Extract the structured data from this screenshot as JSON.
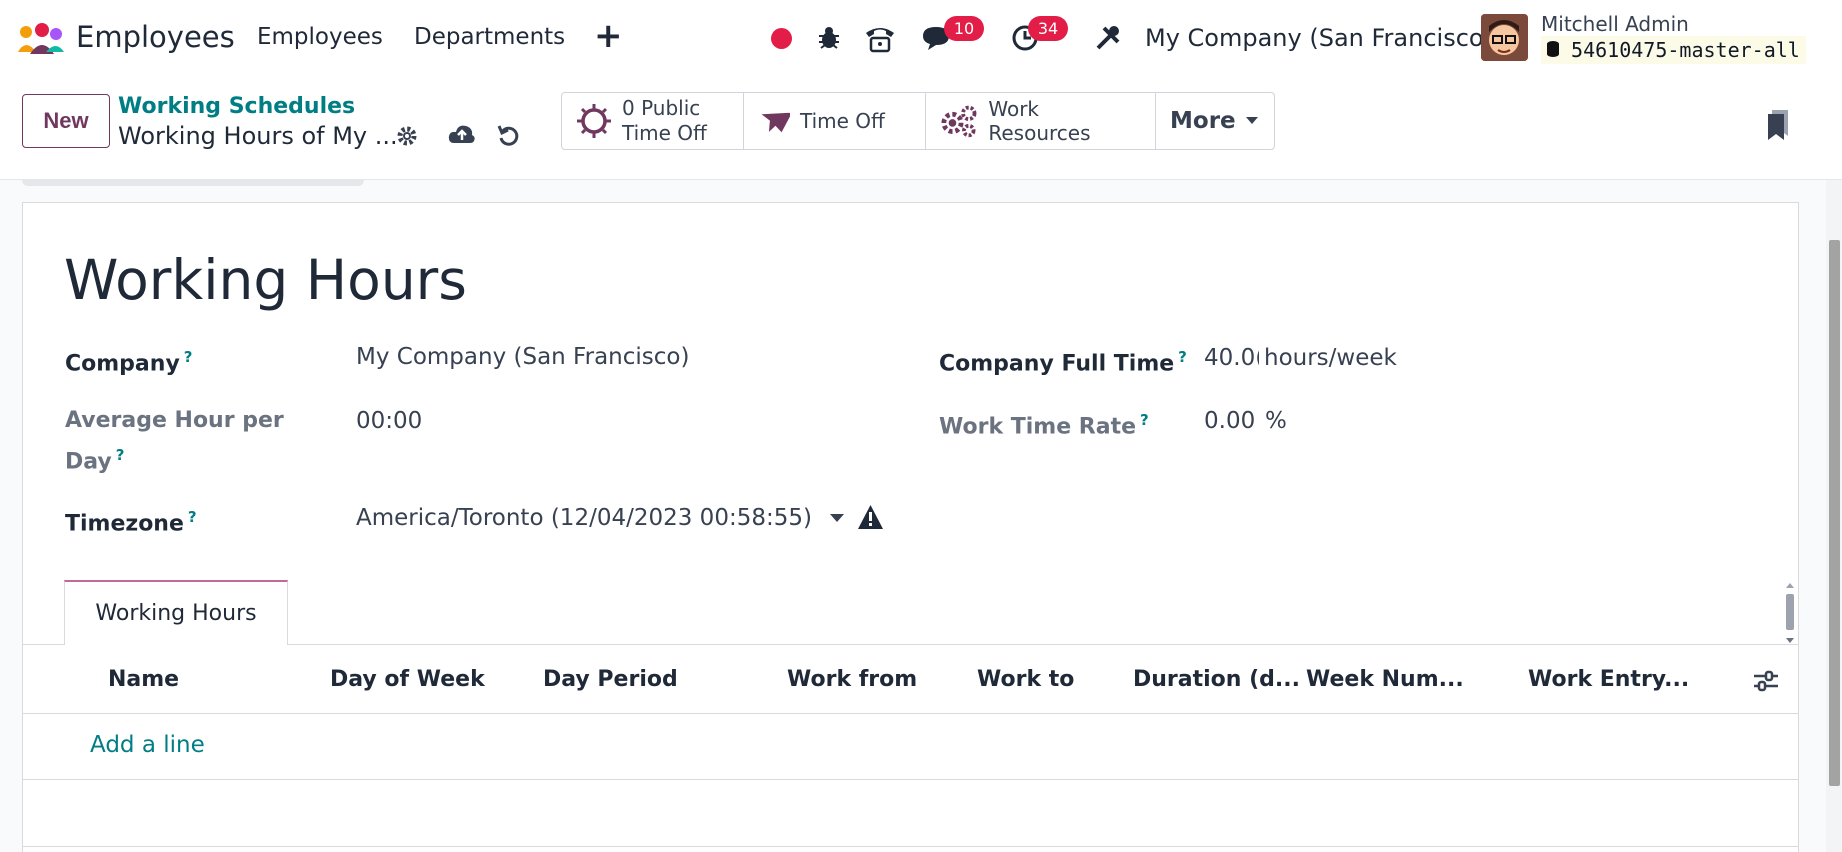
{
  "nav": {
    "app_name": "Employees",
    "menu": [
      "Employees",
      "Departments"
    ],
    "plus": "+",
    "messages_count": "10",
    "activities_count": "34",
    "company": "My Company (San Francisco)",
    "user_name": "Mitchell Admin",
    "database": "54610475-master-all"
  },
  "control": {
    "new_label": "New",
    "breadcrumb_parent": "Working Schedules",
    "breadcrumb_current": "Working Hours of My ...",
    "smart_buttons": {
      "public_time_off_line1": "0 Public",
      "public_time_off_line2": "Time Off",
      "time_off": "Time Off",
      "work_resources": "Work Resources",
      "more": "More"
    }
  },
  "form": {
    "title": "Working Hours",
    "company_label": "Company",
    "company_value": "My Company (San Francisco)",
    "avg_label_1": "Average Hour per",
    "avg_label_2": "Day",
    "avg_value": "00:00",
    "timezone_label": "Timezone",
    "timezone_value": "America/Toronto (12/04/2023 00:58:55)",
    "full_time_label": "Company Full Time",
    "full_time_value": "40.0(",
    "full_time_unit": "hours/week",
    "rate_label": "Work Time Rate",
    "rate_value": "0.00",
    "rate_unit": "%",
    "help_mark": "?"
  },
  "tabs": [
    "Working Hours"
  ],
  "table": {
    "columns": [
      "Name",
      "Day of Week",
      "Day Period",
      "Work from",
      "Work to",
      "Duration (d...",
      "Week Num...",
      "Work Entry..."
    ],
    "add_line": "Add a line"
  },
  "colors": {
    "brand": "#71385f",
    "link": "#017e84",
    "badge": "#e11d48"
  },
  "icons": [
    "app-logo",
    "record-icon",
    "bug-icon",
    "phone-icon",
    "chat-icon",
    "clock-icon",
    "tools-icon",
    "gear-icon",
    "cloud-upload-icon",
    "undo-icon",
    "sun-icon",
    "plane-icon",
    "gears-icon",
    "caret-down-icon",
    "bookmark-icon",
    "warning-icon",
    "column-settings-icon"
  ]
}
